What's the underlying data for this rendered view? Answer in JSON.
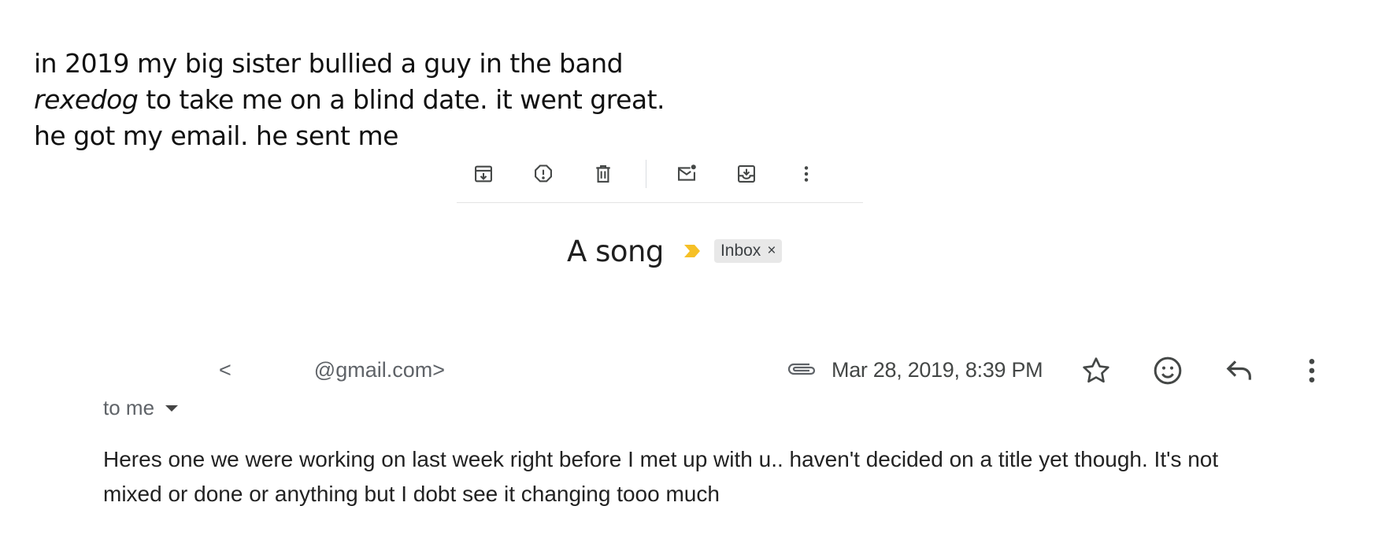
{
  "caption": {
    "line1": "in 2019 my big sister bullied a guy in the band",
    "band_name": "rexedog",
    "line2_rest": " to take me on a blind date. it went great.",
    "line3": "he got my email. he sent me"
  },
  "toolbar": {
    "icons": [
      "archive-icon",
      "report-spam-icon",
      "delete-icon",
      "mark-unread-icon",
      "move-to-icon",
      "more-vert-icon"
    ]
  },
  "email": {
    "subject": "A song",
    "label": "Inbox",
    "label_remove": "×",
    "importance_color": "#f6c026",
    "sender_address": "<              @gmail.com>",
    "date": "Mar 28, 2019, 8:39 PM",
    "recipient": "to me",
    "body_line1": "Heres one we were working on last week right before I met up with u.. haven't decided on a title yet though. It's not",
    "body_line2": "mixed or done or anything but I dobt see it changing tooo much"
  }
}
